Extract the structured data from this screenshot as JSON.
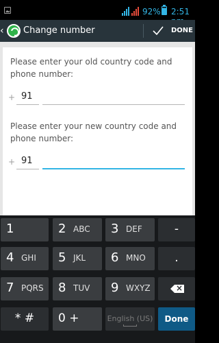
{
  "status_bar": {
    "battery": "92%",
    "time": "2:51 pm"
  },
  "action_bar": {
    "title": "Change number",
    "done_label": "DONE"
  },
  "form": {
    "old_prompt": "Please enter your old country code and phone number:",
    "old_plus": "+",
    "old_country_code": "91",
    "old_phone": "",
    "new_prompt": "Please enter your new country code and phone number:",
    "new_plus": "+",
    "new_country_code": "91",
    "new_phone": ""
  },
  "keyboard": {
    "row1": [
      {
        "num": "1",
        "letters": ""
      },
      {
        "num": "2",
        "letters": "ABC"
      },
      {
        "num": "3",
        "letters": "DEF"
      },
      {
        "label": "-"
      }
    ],
    "row2": [
      {
        "num": "4",
        "letters": "GHI"
      },
      {
        "num": "5",
        "letters": "JKL"
      },
      {
        "num": "6",
        "letters": "MNO"
      },
      {
        "label": "."
      }
    ],
    "row3": [
      {
        "num": "7",
        "letters": "PQRS"
      },
      {
        "num": "8",
        "letters": "TUV"
      },
      {
        "num": "9",
        "letters": "WXYZ"
      }
    ],
    "row4": {
      "star_hash": "* #",
      "zero_plus": "0 +",
      "space": "English (US)",
      "done": "Done"
    }
  },
  "colors": {
    "accent": "#33b5e5",
    "actionbar": "#28343b",
    "whatsapp_green": "#2fb34a",
    "done_key": "#0f5a86"
  }
}
